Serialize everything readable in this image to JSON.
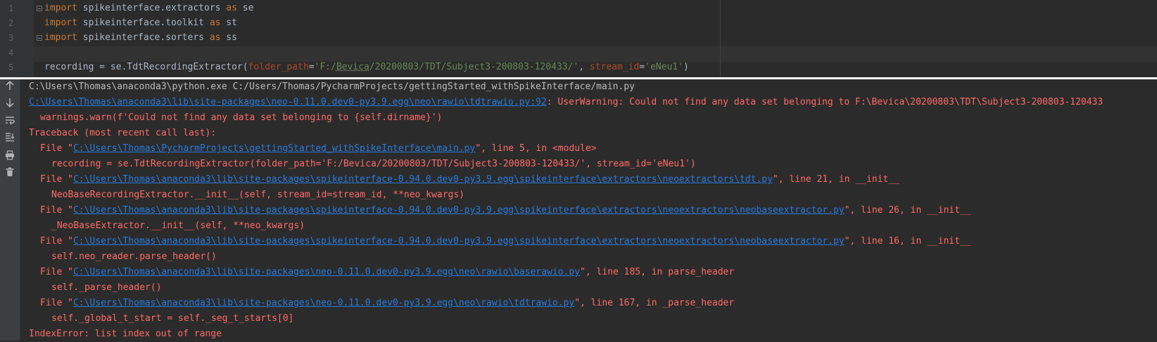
{
  "editor": {
    "line_numbers": [
      "1",
      "2",
      "3",
      "4",
      "5"
    ],
    "lines": [
      {
        "kw": "import",
        "text": " spikeinterface.extractors ",
        "kw2": "as",
        "alias": " se"
      },
      {
        "kw": "import",
        "text": " spikeinterface.toolkit ",
        "kw2": "as",
        "alias": " st"
      },
      {
        "kw": "import",
        "text": " spikeinterface.sorters ",
        "kw2": "as",
        "alias": " ss"
      },
      {},
      {
        "prefix": "recording = se.TdtRecordingExtractor(",
        "param1": "folder_path",
        "eq1": "=",
        "str1_a": "'F:/",
        "str1_b": "Bevica",
        "str1_c": "/20200803/TDT/Subject3-200803-120433/'",
        "comma": ", ",
        "param2": "stream_id",
        "eq2": "=",
        "str2": "'eNeu1'",
        "suffix": ")"
      }
    ]
  },
  "run_toolbar": {
    "icons": [
      "arrow-up-icon",
      "arrow-down-icon",
      "soft-wrap-icon",
      "scroll-to-end-icon",
      "print-icon",
      "trash-icon"
    ]
  },
  "console": {
    "cmd": "C:\\Users\\Thomas\\anaconda3\\python.exe C:/Users/Thomas/PycharmProjects/gettingStarted_withSpikeInterface/main.py",
    "warn_link": "C:\\Users\\Thomas\\anaconda3\\lib\\site-packages\\neo-0.11.0.dev0-py3.9.egg\\neo\\rawio\\tdtrawio.py:92",
    "warn_msg": ": UserWarning: Could not find any data set belonging to F:\\Bevica\\20200803\\TDT\\Subject3-200803-120433",
    "warn_code": "warnings.warn(f'Could not find any data set belonging to {self.dirname}')",
    "traceback_header": "Traceback (most recent call last):",
    "frames": [
      {
        "pre": "File \"",
        "path": "C:\\Users\\Thomas\\PycharmProjects\\gettingStarted_withSpikeInterface\\main.py",
        "post": "\", line 5, in <module>",
        "code": "recording = se.TdtRecordingExtractor(folder_path='F:/Bevica/20200803/TDT/Subject3-200803-120433/', stream_id='eNeu1')"
      },
      {
        "pre": "File \"",
        "path": "C:\\Users\\Thomas\\anaconda3\\lib\\site-packages\\spikeinterface-0.94.0.dev0-py3.9.egg\\spikeinterface\\extractors\\neoextractors\\tdt.py",
        "post": "\", line 21, in __init__",
        "code": "NeoBaseRecordingExtractor.__init__(self, stream_id=stream_id, **neo_kwargs)"
      },
      {
        "pre": "File \"",
        "path": "C:\\Users\\Thomas\\anaconda3\\lib\\site-packages\\spikeinterface-0.94.0.dev0-py3.9.egg\\spikeinterface\\extractors\\neoextractors\\neobaseextractor.py",
        "post": "\", line 26, in __init__",
        "code": "_NeoBaseExtractor.__init__(self, **neo_kwargs)"
      },
      {
        "pre": "File \"",
        "path": "C:\\Users\\Thomas\\anaconda3\\lib\\site-packages\\spikeinterface-0.94.0.dev0-py3.9.egg\\spikeinterface\\extractors\\neoextractors\\neobaseextractor.py",
        "post": "\", line 16, in __init__",
        "code": "self.neo_reader.parse_header()"
      },
      {
        "pre": "File \"",
        "path": "C:\\Users\\Thomas\\anaconda3\\lib\\site-packages\\neo-0.11.0.dev0-py3.9.egg\\neo\\rawio\\baserawio.py",
        "post": "\", line 185, in parse_header",
        "code": "self._parse_header()"
      },
      {
        "pre": "File \"",
        "path": "C:\\Users\\Thomas\\anaconda3\\lib\\site-packages\\neo-0.11.0.dev0-py3.9.egg\\neo\\rawio\\tdtrawio.py",
        "post": "\", line 167, in _parse_header",
        "code": "self._global_t_start = self._seg_t_starts[0]"
      }
    ],
    "error": "IndexError: list index out of range"
  },
  "colors": {
    "background": "#2b2b2b",
    "error_text": "#ff6b68",
    "link": "#287bde",
    "keyword": "#cc7832",
    "string": "#6a8759",
    "param": "#aa4926",
    "plain_text": "#bbbbbb"
  }
}
